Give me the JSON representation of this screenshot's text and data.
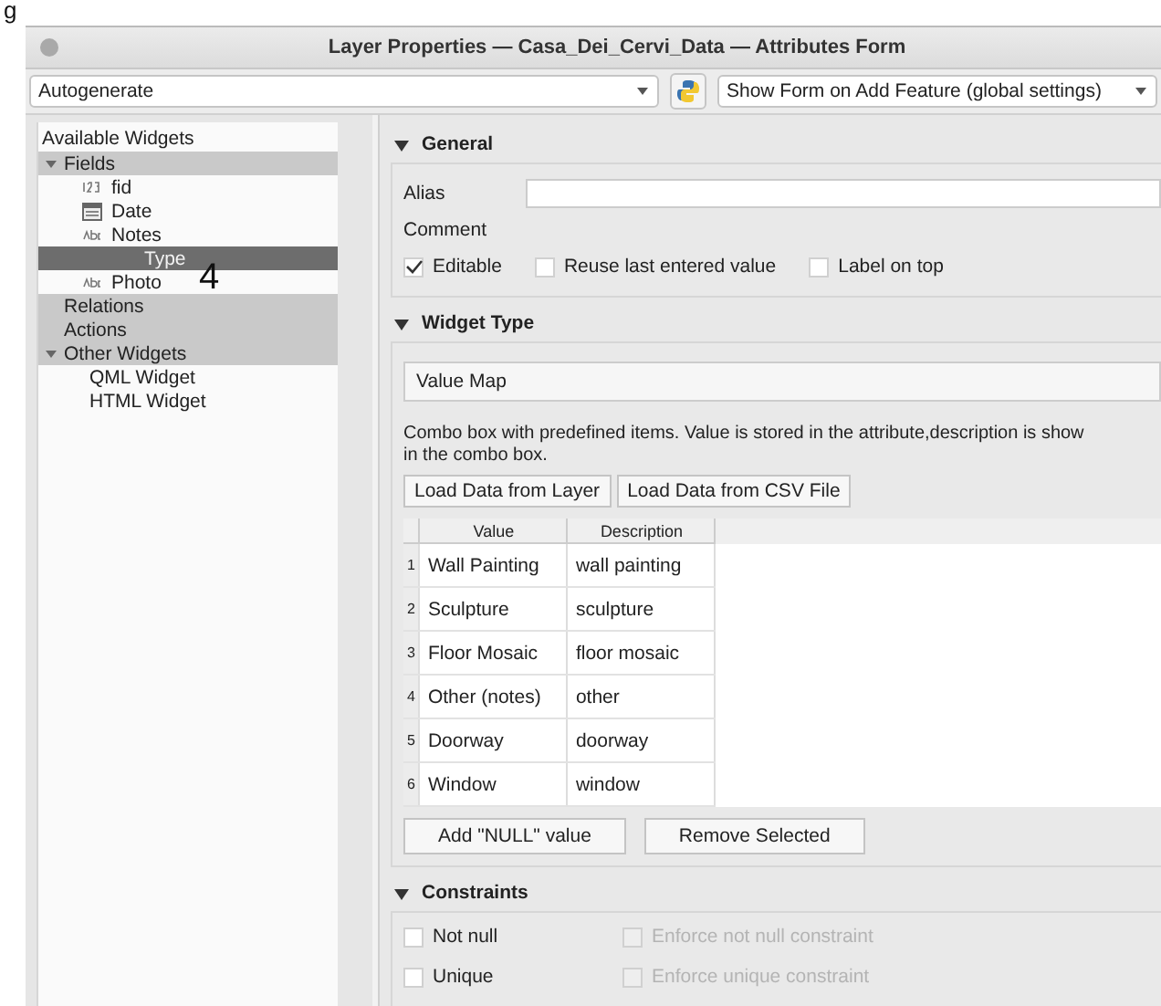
{
  "caption_fragment": "g",
  "window": {
    "title": "Layer Properties — Casa_Dei_Cervi_Data — Attributes Form"
  },
  "toolbar": {
    "layout_combo": "Autogenerate",
    "form_combo": "Show Form on Add Feature (global settings)"
  },
  "tree": {
    "header": "Available Widgets",
    "items": [
      {
        "label": "Fields",
        "expanded": true,
        "children": [
          {
            "label": "fid",
            "kind": "integer",
            "selected": false
          },
          {
            "label": "Date",
            "kind": "date",
            "selected": false
          },
          {
            "label": "Notes",
            "kind": "text",
            "selected": false
          },
          {
            "label": "Type",
            "kind": "text",
            "selected": true
          },
          {
            "label": "Photo",
            "kind": "text",
            "selected": false
          }
        ]
      },
      {
        "label": "Relations"
      },
      {
        "label": "Actions"
      },
      {
        "label": "Other Widgets",
        "expanded": true,
        "children": [
          {
            "label": "QML Widget",
            "kind": "widget",
            "selected": false
          },
          {
            "label": "HTML Widget",
            "kind": "widget",
            "selected": false
          }
        ]
      }
    ]
  },
  "callout": "4",
  "general": {
    "title": "General",
    "alias_label": "Alias",
    "comment_label": "Comment",
    "checks": [
      {
        "label": "Editable",
        "checked": true
      },
      {
        "label": "Reuse last entered value",
        "checked": false
      },
      {
        "label": "Label on top",
        "checked": false
      }
    ]
  },
  "widget_type": {
    "title": "Widget Type",
    "combo": "Value Map",
    "description": "Combo box with predefined items. Value is stored in the attribute,description is show\nin the combo box.",
    "buttons": [
      "Load Data from Layer",
      "Load Data from CSV File"
    ],
    "table": {
      "columns": [
        "Value",
        "Description"
      ],
      "rows": [
        {
          "num": "1",
          "value": "Wall Painting",
          "description": "wall painting"
        },
        {
          "num": "2",
          "value": "Sculpture",
          "description": "sculpture"
        },
        {
          "num": "3",
          "value": "Floor Mosaic",
          "description": "floor mosaic"
        },
        {
          "num": "4",
          "value": "Other (notes)",
          "description": "other"
        },
        {
          "num": "5",
          "value": "Doorway",
          "description": "doorway"
        },
        {
          "num": "6",
          "value": "Window",
          "description": "window"
        }
      ]
    },
    "bottom_buttons": [
      "Add \"NULL\" value",
      "Remove Selected"
    ]
  },
  "constraints": {
    "title": "Constraints",
    "rows": [
      {
        "label": "Not null",
        "checked": false,
        "enforce_label": "Enforce not null constraint",
        "enforce_disabled": true
      },
      {
        "label": "Unique",
        "checked": false,
        "enforce_label": "Enforce unique constraint",
        "enforce_disabled": true
      }
    ]
  }
}
